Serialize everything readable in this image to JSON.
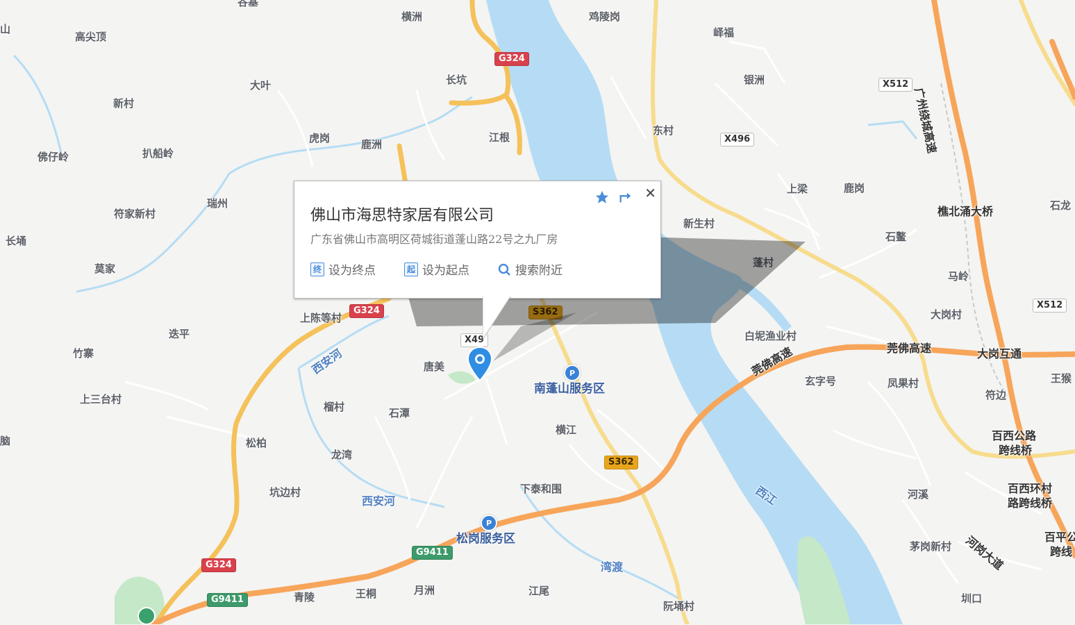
{
  "map": {
    "labels": [
      {
        "id": "gaojianding",
        "text": "高尖顶"
      },
      {
        "id": "dazy",
        "text": "大叶"
      },
      {
        "id": "xincun",
        "text": "新村"
      },
      {
        "id": "fozailing",
        "text": "佛仔岭"
      },
      {
        "id": "bachuanling",
        "text": "扒船岭"
      },
      {
        "id": "fujiaxincun",
        "text": "符家新村"
      },
      {
        "id": "ruizhou",
        "text": "瑞州"
      },
      {
        "id": "changyong",
        "text": "长埇"
      },
      {
        "id": "mojia",
        "text": "莫家"
      },
      {
        "id": "hugang",
        "text": "虎岗"
      },
      {
        "id": "luzhou",
        "text": "鹿洲"
      },
      {
        "id": "hengzhou",
        "text": "横洲"
      },
      {
        "id": "changkeng",
        "text": "长坑"
      },
      {
        "id": "jianggen",
        "text": "江根"
      },
      {
        "id": "jilinggang",
        "text": "鸡陵岗"
      },
      {
        "id": "xiafu",
        "text": "峄福"
      },
      {
        "id": "yinzhou",
        "text": "银洲"
      },
      {
        "id": "dongcun",
        "text": "东村"
      },
      {
        "id": "shangliang",
        "text": "上梁"
      },
      {
        "id": "lugang",
        "text": "鹿岗"
      },
      {
        "id": "xinshengcun",
        "text": "新生村"
      },
      {
        "id": "shipan",
        "text": "石鳌"
      },
      {
        "id": "pengcun",
        "text": "蓬村"
      },
      {
        "id": "maling",
        "text": "马岭"
      },
      {
        "id": "shilong",
        "text": "石龙"
      },
      {
        "id": "dagangcun",
        "text": "大岗村"
      },
      {
        "id": "bainiyuye",
        "text": "白坭渔业村"
      },
      {
        "id": "shangchen",
        "text": "上陈等村"
      },
      {
        "id": "dieping",
        "text": "迭平"
      },
      {
        "id": "zhuzhai",
        "text": "竹寨"
      },
      {
        "id": "shangsantai",
        "text": "上三台村"
      },
      {
        "id": "tangmei",
        "text": "唐美"
      },
      {
        "id": "liucun",
        "text": "榴村"
      },
      {
        "id": "shitan",
        "text": "石潭"
      },
      {
        "id": "songbai",
        "text": "松柏"
      },
      {
        "id": "longwan",
        "text": "龙湾"
      },
      {
        "id": "kengbiancun",
        "text": "坑边村"
      },
      {
        "id": "hengjiang",
        "text": "横江"
      },
      {
        "id": "xiataihewei",
        "text": "下泰和围"
      },
      {
        "id": "xuanzihao",
        "text": "玄字号"
      },
      {
        "id": "fengguocun",
        "text": "凤果村"
      },
      {
        "id": "fubian",
        "text": "符边"
      },
      {
        "id": "hexi",
        "text": "河溪"
      },
      {
        "id": "maogangxincun",
        "text": "茅岗新村"
      },
      {
        "id": "wangbao",
        "text": "王猴"
      },
      {
        "id": "qingling",
        "text": "青陵"
      },
      {
        "id": "wangtong",
        "text": "王桐"
      },
      {
        "id": "yuezhou",
        "text": "月洲"
      },
      {
        "id": "jiangwei",
        "text": "江尾"
      },
      {
        "id": "ruanyongcun",
        "text": "阮埇村"
      },
      {
        "id": "kengkou",
        "text": "圳口"
      },
      {
        "id": "gutou",
        "text": "谷基"
      },
      {
        "id": "shan",
        "text": "山"
      },
      {
        "id": "nao",
        "text": "脑"
      }
    ],
    "poi_labels": [
      {
        "id": "nanpengshan",
        "text": "南蓬山服务区"
      },
      {
        "id": "songgang",
        "text": "松岗服务区"
      },
      {
        "id": "qiaobeiyong",
        "text": "樵北涌大桥"
      },
      {
        "id": "dagang_interchange",
        "text": "大岗互通"
      },
      {
        "id": "baixi1",
        "text": "百西公路"
      },
      {
        "id": "baixi2",
        "text": "跨线桥"
      },
      {
        "id": "baixihuan1",
        "text": "百西环村"
      },
      {
        "id": "baixihuan2",
        "text": "路跨线桥"
      },
      {
        "id": "baiping1",
        "text": "百平公"
      },
      {
        "id": "baiping2",
        "text": "跨线"
      },
      {
        "id": "wanfu",
        "text": "湾渡"
      }
    ],
    "water_labels": [
      {
        "id": "xianhe1",
        "text": "西安河"
      },
      {
        "id": "xianhe2",
        "text": "西安河"
      },
      {
        "id": "xijiang",
        "text": "西江"
      }
    ],
    "road_labels": [
      {
        "id": "guangzhou_ring",
        "text": "广州绕城高速"
      },
      {
        "id": "guanfo",
        "text": "莞佛高速"
      },
      {
        "id": "guanfo2",
        "text": "莞佛高速"
      },
      {
        "id": "hegang",
        "text": "河岗大道"
      }
    ],
    "shields": [
      {
        "id": "g324a",
        "text": "G324",
        "kind": "g"
      },
      {
        "id": "g324b",
        "text": "G324",
        "kind": "g"
      },
      {
        "id": "g324c",
        "text": "G324",
        "kind": "g"
      },
      {
        "id": "g9411a",
        "text": "G9411",
        "kind": "e"
      },
      {
        "id": "g9411b",
        "text": "G9411",
        "kind": "e"
      },
      {
        "id": "s362a",
        "text": "S362",
        "kind": "s"
      },
      {
        "id": "s362b",
        "text": "S362",
        "kind": "s"
      },
      {
        "id": "x496a",
        "text": "X496",
        "kind": "x"
      },
      {
        "id": "x496b",
        "text": "X49",
        "kind": "x"
      },
      {
        "id": "x512a",
        "text": "X512",
        "kind": "x"
      },
      {
        "id": "x512b",
        "text": "X512",
        "kind": "x"
      }
    ],
    "colors": {
      "water": "#b5dcf4",
      "highway": "#f7a55a",
      "national": "#f5c15a",
      "provincial": "#f7dc8e",
      "local": "#ffffff",
      "green": "#c5e8c8"
    }
  },
  "popup": {
    "title": "佛山市海思特家居有限公司",
    "address": "广东省佛山市高明区荷城街道蓬山路22号之九厂房",
    "actions": [
      {
        "icon": "终",
        "label": "设为终点"
      },
      {
        "icon": "起",
        "label": "设为起点"
      },
      {
        "icon": "search-nearby-icon",
        "label": "搜索附近"
      }
    ],
    "close": "✕",
    "icons": [
      "favorite-star-icon",
      "share-icon"
    ]
  }
}
